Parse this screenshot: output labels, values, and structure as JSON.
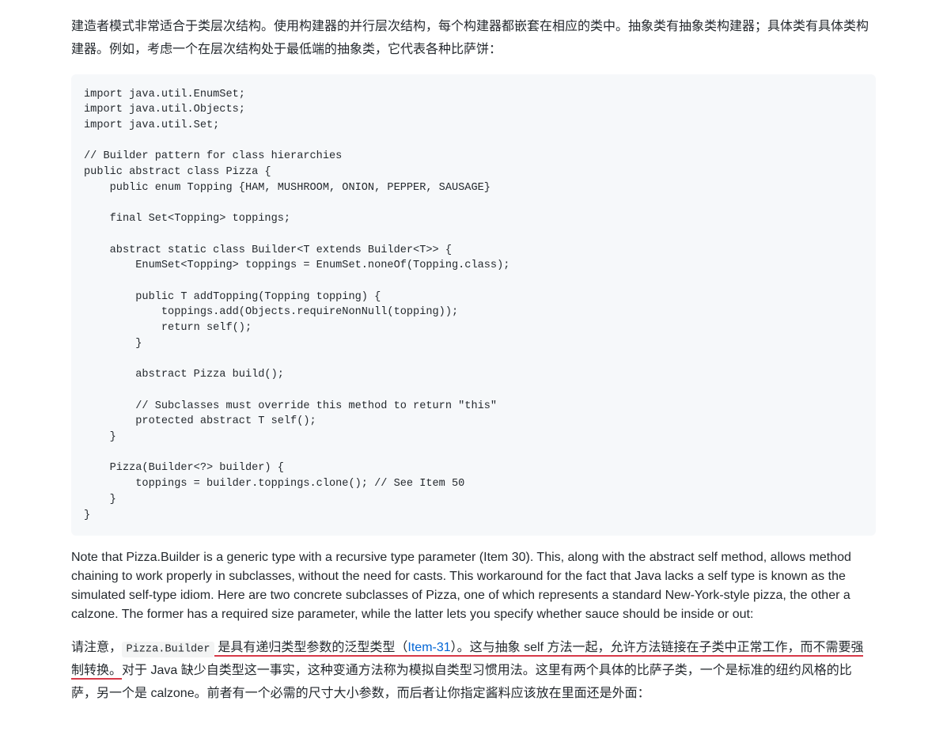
{
  "intro_paragraph_cn": "建造者模式非常适合于类层次结构。使用构建器的并行层次结构，每个构建器都嵌套在相应的类中。抽象类有抽象类构建器；具体类有具体类构建器。例如，考虑一个在层次结构处于最低端的抽象类，它代表各种比萨饼：",
  "code": "import java.util.EnumSet;\nimport java.util.Objects;\nimport java.util.Set;\n\n// Builder pattern for class hierarchies\npublic abstract class Pizza {\n    public enum Topping {HAM, MUSHROOM, ONION, PEPPER, SAUSAGE}\n\n    final Set<Topping> toppings;\n\n    abstract static class Builder<T extends Builder<T>> {\n        EnumSet<Topping> toppings = EnumSet.noneOf(Topping.class);\n\n        public T addTopping(Topping topping) {\n            toppings.add(Objects.requireNonNull(topping));\n            return self();\n        }\n\n        abstract Pizza build();\n\n        // Subclasses must override this method to return \"this\"\n        protected abstract T self();\n    }\n\n    Pizza(Builder<?> builder) {\n        toppings = builder.toppings.clone(); // See Item 50\n    }\n}",
  "english_paragraph": "Note that Pizza.Builder is a generic type with a recursive type parameter (Item 30). This, along with the abstract self method, allows method chaining to work properly in subclasses, without the need for casts. This workaround for the fact that Java lacks a self type is known as the simulated self-type idiom. Here are two concrete subclasses of Pizza, one of which represents a standard New-York-style pizza, the other a calzone. The former has a required size parameter, while the latter lets you specify whether sauce should be inside or out:",
  "closing_cn": {
    "prefix": "请注意，",
    "inline_code": "Pizza.Builder",
    "part1": " 是具有递归类型参数的泛型类型（",
    "link_text": "Item-31",
    "part2": "）。这与抽象 self 方法一起，允许方法链接在子类中正常工作，而不需要强制转换。",
    "part3": "对于 Java 缺少自类型这一事实，这种变通方法称为模拟自类型习惯用法。这里有两个具体的比萨子类，一个是标准的纽约风格的比萨，另一个是 calzone。前者有一个必需的尺寸大小参数，而后者让你指定酱料应该放在里面还是外面："
  }
}
